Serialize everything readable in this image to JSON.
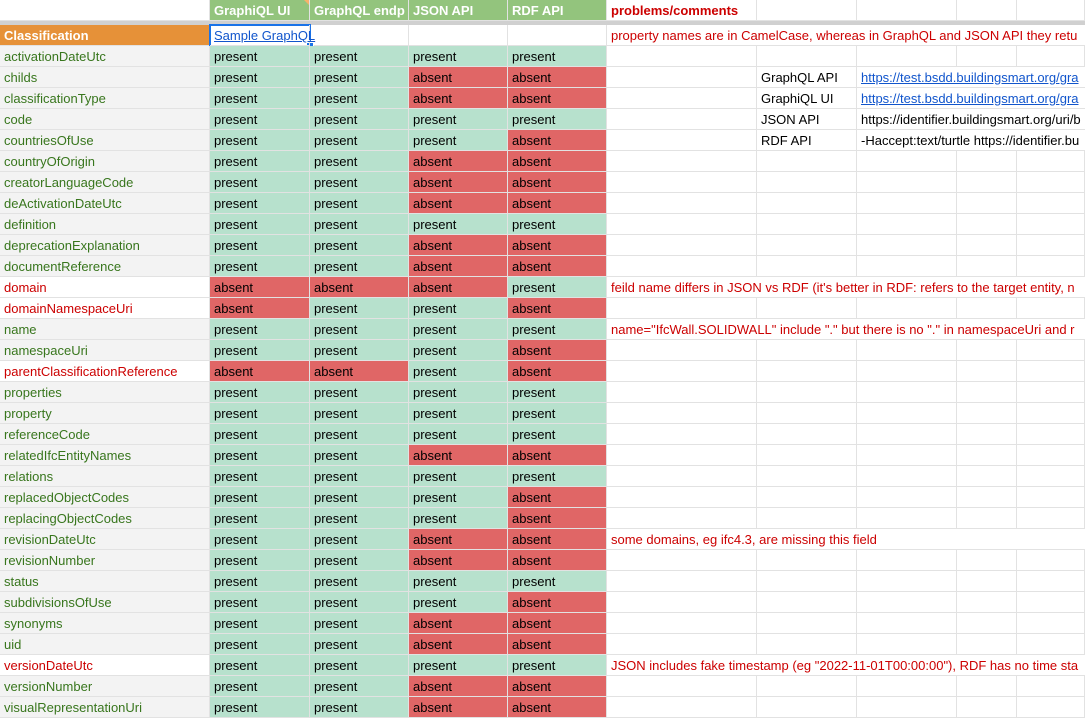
{
  "header": {
    "col1": "",
    "col2": "GraphiQL UI",
    "col3": "GraphQL endp",
    "col4": "JSON API",
    "col5": "RDF API",
    "col6": "problems/comments"
  },
  "colors": {
    "present": "#b7e1cd",
    "absent": "#e06666",
    "header_bg": "#93c47d",
    "classification_bg": "#e69138",
    "name_green": "#38761d",
    "name_red": "#cc0000",
    "link": "#1155cc"
  },
  "classification_row": {
    "label": "Classification",
    "link": "Sample GraphQL",
    "comment": "property names are in CamelCase, whereas in GraphQL and JSON API they retu"
  },
  "rows": [
    {
      "name": "activationDateUtc",
      "red": false,
      "v": [
        "present",
        "present",
        "present",
        "present"
      ],
      "comment": ""
    },
    {
      "name": "childs",
      "red": false,
      "v": [
        "present",
        "present",
        "absent",
        "absent"
      ],
      "comment": ""
    },
    {
      "name": "classificationType",
      "red": false,
      "v": [
        "present",
        "present",
        "absent",
        "absent"
      ],
      "comment": ""
    },
    {
      "name": "code",
      "red": false,
      "v": [
        "present",
        "present",
        "present",
        "present"
      ],
      "comment": ""
    },
    {
      "name": "countriesOfUse",
      "red": false,
      "v": [
        "present",
        "present",
        "present",
        "absent"
      ],
      "comment": ""
    },
    {
      "name": "countryOfOrigin",
      "red": false,
      "v": [
        "present",
        "present",
        "absent",
        "absent"
      ],
      "comment": ""
    },
    {
      "name": "creatorLanguageCode",
      "red": false,
      "v": [
        "present",
        "present",
        "absent",
        "absent"
      ],
      "comment": ""
    },
    {
      "name": "deActivationDateUtc",
      "red": false,
      "v": [
        "present",
        "present",
        "absent",
        "absent"
      ],
      "comment": ""
    },
    {
      "name": "definition",
      "red": false,
      "v": [
        "present",
        "present",
        "present",
        "present"
      ],
      "comment": ""
    },
    {
      "name": "deprecationExplanation",
      "red": false,
      "v": [
        "present",
        "present",
        "absent",
        "absent"
      ],
      "comment": ""
    },
    {
      "name": "documentReference",
      "red": false,
      "v": [
        "present",
        "present",
        "absent",
        "absent"
      ],
      "comment": ""
    },
    {
      "name": "domain",
      "red": true,
      "v": [
        "absent",
        "absent",
        "absent",
        "present"
      ],
      "comment": "feild name differs in JSON vs RDF (it's better in RDF: refers to the target entity, n"
    },
    {
      "name": "domainNamespaceUri",
      "red": true,
      "v": [
        "absent",
        "present",
        "present",
        "absent"
      ],
      "comment": ""
    },
    {
      "name": "name",
      "red": false,
      "v": [
        "present",
        "present",
        "present",
        "present"
      ],
      "comment": "name=\"IfcWall.SOLIDWALL\" include \".\" but there is no \".\" in namespaceUri and r"
    },
    {
      "name": "namespaceUri",
      "red": false,
      "v": [
        "present",
        "present",
        "present",
        "absent"
      ],
      "comment": ""
    },
    {
      "name": "parentClassificationReference",
      "red": true,
      "v": [
        "absent",
        "absent",
        "present",
        "absent"
      ],
      "comment": ""
    },
    {
      "name": "properties",
      "red": false,
      "v": [
        "present",
        "present",
        "present",
        "present"
      ],
      "comment": ""
    },
    {
      "name": "property",
      "red": false,
      "v": [
        "present",
        "present",
        "present",
        "present"
      ],
      "comment": ""
    },
    {
      "name": "referenceCode",
      "red": false,
      "v": [
        "present",
        "present",
        "present",
        "present"
      ],
      "comment": ""
    },
    {
      "name": "relatedIfcEntityNames",
      "red": false,
      "v": [
        "present",
        "present",
        "absent",
        "absent"
      ],
      "comment": ""
    },
    {
      "name": "relations",
      "red": false,
      "v": [
        "present",
        "present",
        "present",
        "present"
      ],
      "comment": ""
    },
    {
      "name": "replacedObjectCodes",
      "red": false,
      "v": [
        "present",
        "present",
        "present",
        "absent"
      ],
      "comment": ""
    },
    {
      "name": "replacingObjectCodes",
      "red": false,
      "v": [
        "present",
        "present",
        "present",
        "absent"
      ],
      "comment": ""
    },
    {
      "name": "revisionDateUtc",
      "red": false,
      "v": [
        "present",
        "present",
        "absent",
        "absent"
      ],
      "comment": "some domains, eg ifc4.3, are missing this field"
    },
    {
      "name": "revisionNumber",
      "red": false,
      "v": [
        "present",
        "present",
        "absent",
        "absent"
      ],
      "comment": ""
    },
    {
      "name": "status",
      "red": false,
      "v": [
        "present",
        "present",
        "present",
        "present"
      ],
      "comment": ""
    },
    {
      "name": "subdivisionsOfUse",
      "red": false,
      "v": [
        "present",
        "present",
        "present",
        "absent"
      ],
      "comment": ""
    },
    {
      "name": "synonyms",
      "red": false,
      "v": [
        "present",
        "present",
        "absent",
        "absent"
      ],
      "comment": ""
    },
    {
      "name": "uid",
      "red": false,
      "v": [
        "present",
        "present",
        "absent",
        "absent"
      ],
      "comment": ""
    },
    {
      "name": "versionDateUtc",
      "red": true,
      "v": [
        "present",
        "present",
        "present",
        "present"
      ],
      "comment": "JSON includes fake timestamp (eg \"2022-11-01T00:00:00\"), RDF has no time sta"
    },
    {
      "name": "versionNumber",
      "red": false,
      "v": [
        "present",
        "present",
        "absent",
        "absent"
      ],
      "comment": ""
    },
    {
      "name": "visualRepresentationUri",
      "red": false,
      "v": [
        "present",
        "present",
        "absent",
        "absent"
      ],
      "comment": ""
    }
  ],
  "api_links": [
    {
      "label": "GraphQL API",
      "value": "https://test.bsdd.buildingsmart.org/gra",
      "is_link": true
    },
    {
      "label": "GraphiQL UI",
      "value": "https://test.bsdd.buildingsmart.org/gra",
      "is_link": true
    },
    {
      "label": "JSON API",
      "value": "https://identifier.buildingsmart.org/uri/b",
      "is_link": false
    },
    {
      "label": "RDF API",
      "value": "-Haccept:text/turtle https://identifier.bu",
      "is_link": false
    }
  ]
}
